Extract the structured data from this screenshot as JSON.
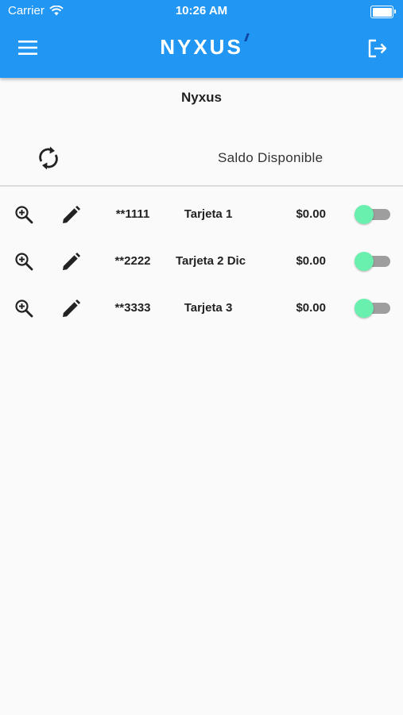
{
  "status_bar": {
    "carrier": "Carrier",
    "time": "10:26 AM"
  },
  "appbar": {
    "logo": "NYXUS",
    "background_color": "#2196f3",
    "menu_icon": "hamburger-menu-icon",
    "logout_icon": "logout-icon"
  },
  "page": {
    "title": "Nyxus"
  },
  "summary": {
    "refresh_icon": "refresh-icon",
    "saldo_label": "Saldo Disponible"
  },
  "cards": [
    {
      "number": "**1111",
      "name": "Tarjeta 1",
      "balance": "$0.00",
      "enabled": true
    },
    {
      "number": "**2222",
      "name": "Tarjeta 2 Dic",
      "balance": "$0.00",
      "enabled": true
    },
    {
      "number": "**3333",
      "name": "Tarjeta 3",
      "balance": "$0.00",
      "enabled": true
    }
  ],
  "colors": {
    "accent": "#2196f3",
    "toggle_on": "#69f0ae",
    "toggle_track": "#9e9e9e"
  }
}
